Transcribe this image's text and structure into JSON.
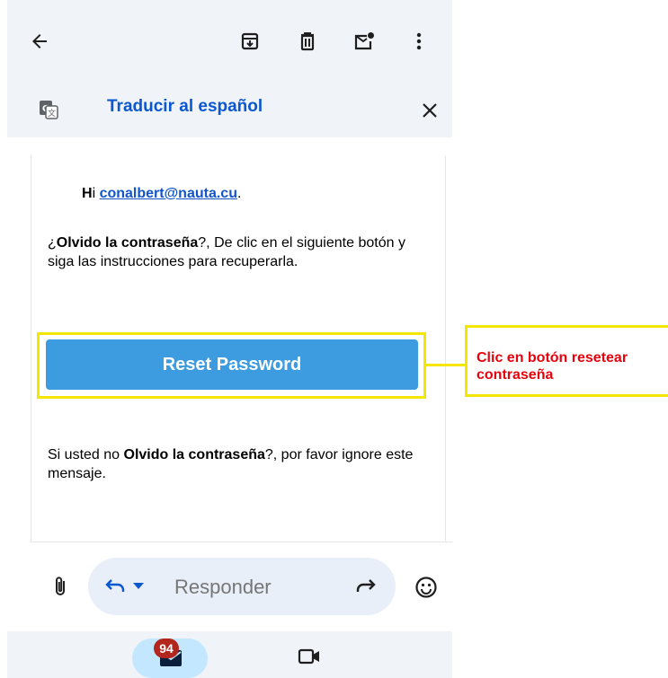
{
  "toolbar": {
    "icons": [
      "back-arrow-icon",
      "archive-icon",
      "delete-icon",
      "mark-unread-icon",
      "more-vert-icon"
    ]
  },
  "translate": {
    "label": "Traducir al español",
    "icon": "google-translate-icon"
  },
  "email": {
    "greeting_prefix": "H",
    "greeting_i": "i ",
    "email_address": "conalbert@nauta.cu",
    "greeting_end": ".",
    "para1_start": "¿",
    "para1_bold": "Olvido la contraseña",
    "para1_rest": "?, De clic en el siguiente botón y siga las instrucciones para recuperarla.",
    "reset_button": "Reset Password",
    "para2_start": "Si usted no ",
    "para2_bold": "Olvido la contraseña",
    "para2_rest": "?, por favor ignore este mensaje."
  },
  "compose": {
    "reply_placeholder": "Responder"
  },
  "bottom_nav": {
    "mail_badge": "94"
  },
  "annotation": {
    "note": "Clic en botón resetear contraseña",
    "highlight_color": "#f5e600",
    "note_color": "#e8000b"
  },
  "colors": {
    "link": "#1155cc",
    "translate_text": "#0b57d0",
    "button": "#3d9be0",
    "badge": "#b3261e",
    "toolbar_bg": "#f0f4f9"
  }
}
